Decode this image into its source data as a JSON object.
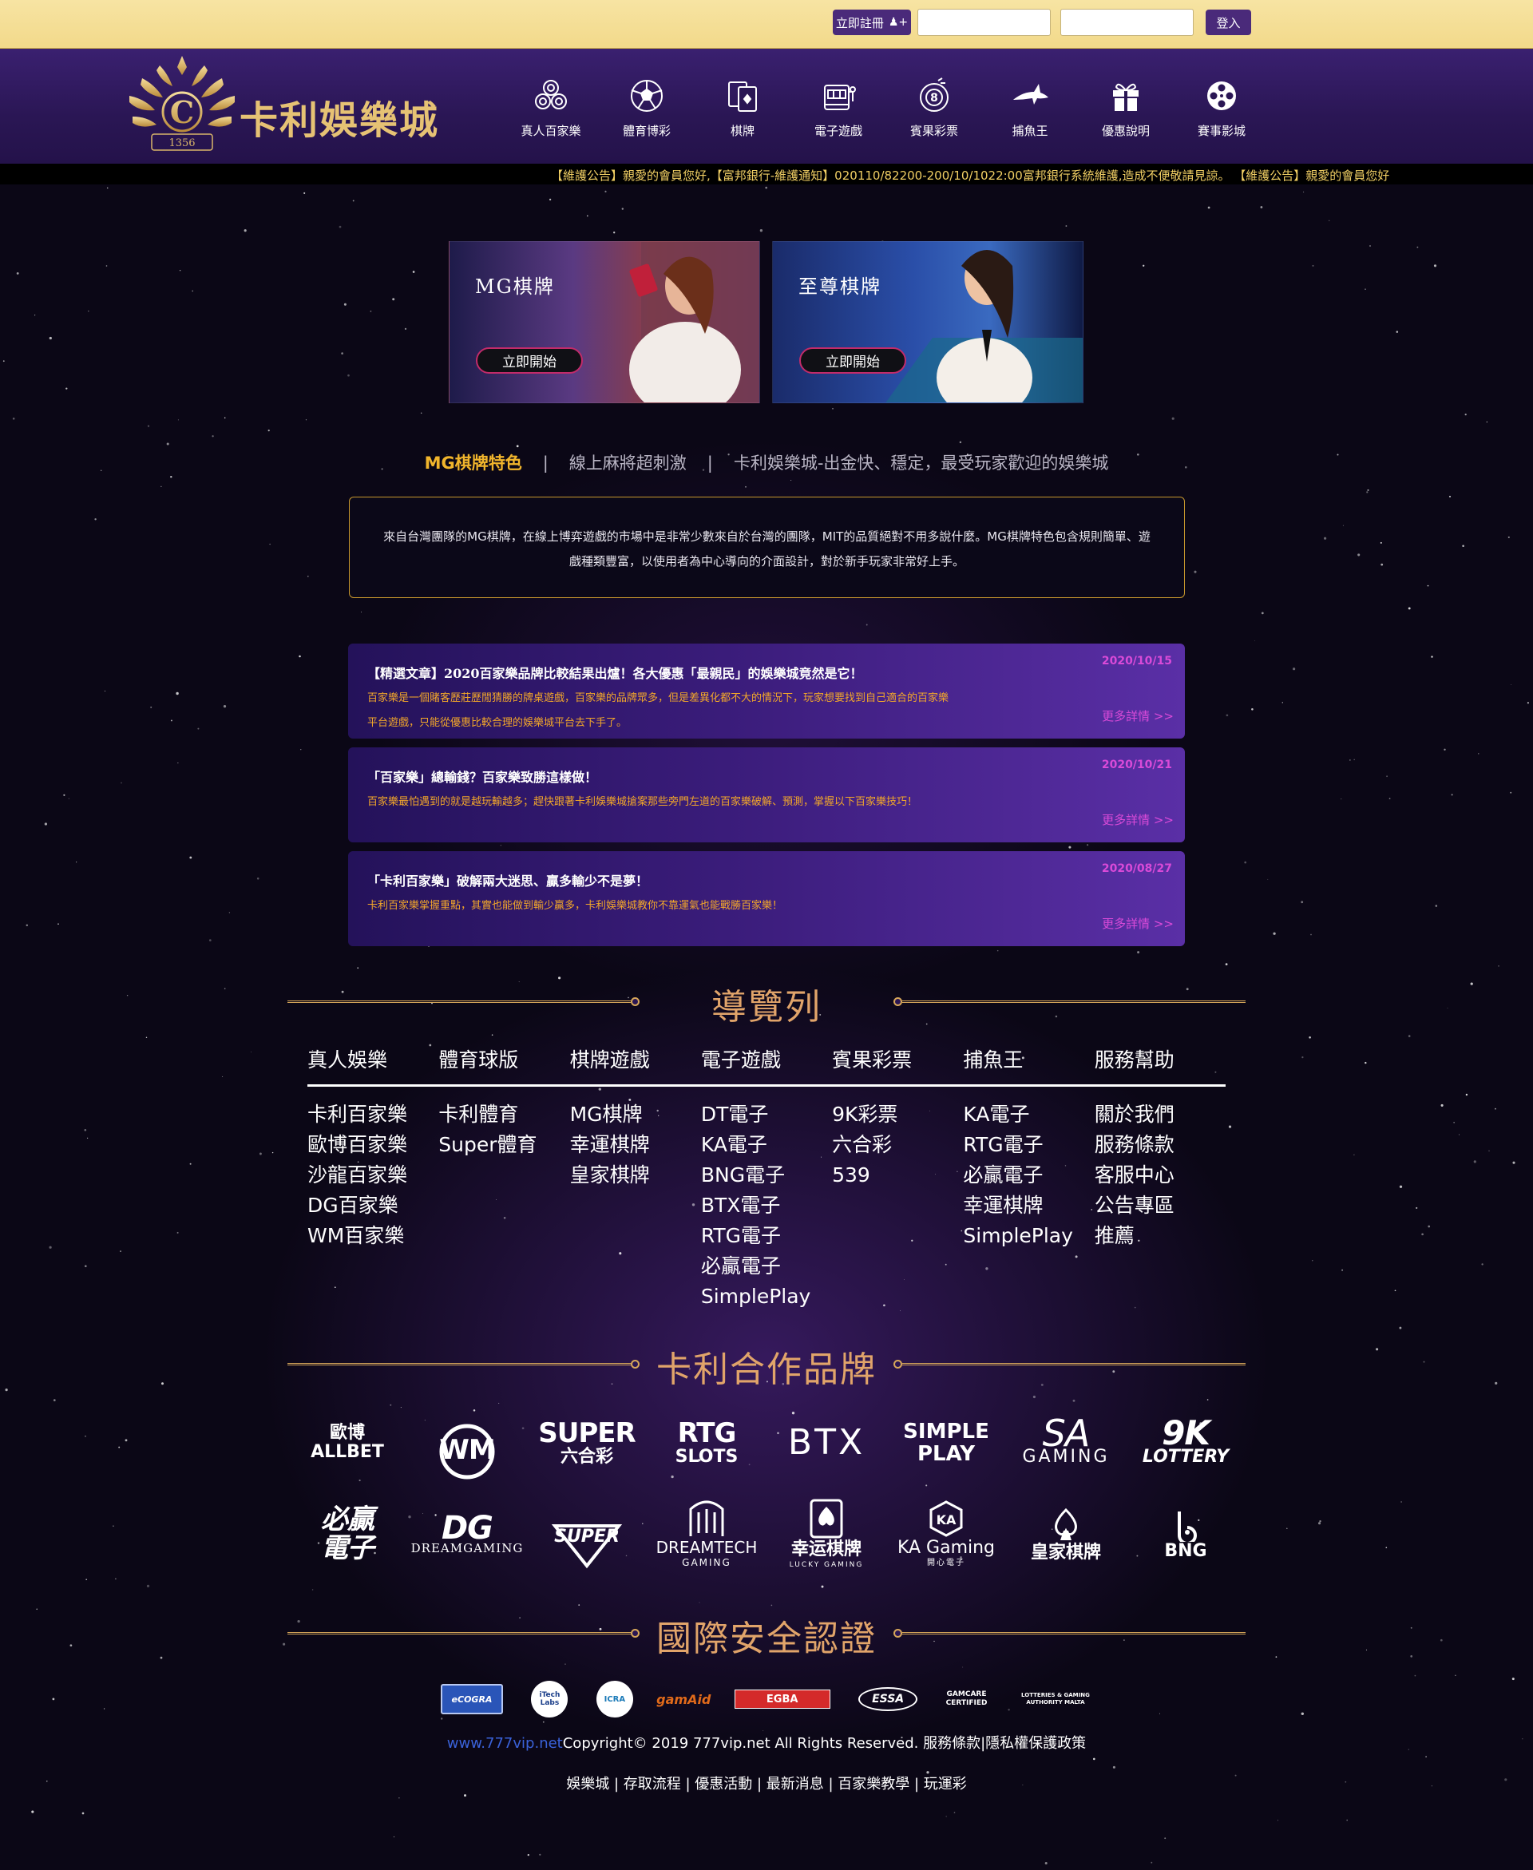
{
  "topbar": {
    "register_label": "立即註冊",
    "username_placeholder": "",
    "password_placeholder": "",
    "login_label": "登入"
  },
  "header": {
    "logo_text": "卡利娛樂城",
    "logo_number": "1356",
    "nav": [
      {
        "label": "真人百家樂",
        "icon": "chips-icon"
      },
      {
        "label": "體育博彩",
        "icon": "soccer-ball-icon"
      },
      {
        "label": "棋牌",
        "icon": "cards-icon"
      },
      {
        "label": "電子遊戲",
        "icon": "slot-machine-icon"
      },
      {
        "label": "賓果彩票",
        "icon": "bingo-ball-icon"
      },
      {
        "label": "捕魚王",
        "icon": "shark-icon"
      },
      {
        "label": "優惠說明",
        "icon": "gift-icon"
      },
      {
        "label": "賽事影城",
        "icon": "film-reel-icon"
      }
    ]
  },
  "marquee": "【維護公告】親愛的會員您好,【富邦銀行-維護通知】020110/82200-200/10/1022:00富邦銀行系統維護,造成不便敬請見諒。 【維護公告】親愛的會員您好",
  "banners": [
    {
      "title": "MG棋牌",
      "button": "立即開始"
    },
    {
      "title": "至尊棋牌",
      "button": "立即開始"
    }
  ],
  "section": {
    "highlight": "MG棋牌特色",
    "sep": "|",
    "sub1": "線上麻將超刺激",
    "sub2": "卡利娛樂城-出金快、穩定，最受玩家歡迎的娛樂城"
  },
  "intro": "來自台灣團隊的MG棋牌，在線上博弈遊戲的市場中是非常少數來自於台灣的團隊，MIT的品質絕對不用多說什麼。MG棋牌特色包含規則簡單、遊戲種類豐富，以使用者為中心導向的介面設計，對於新手玩家非常好上手。",
  "articles": [
    {
      "date": "2020/10/15",
      "title": "【精選文章】2020百家樂品牌比較結果出爐！各大優惠「最親民」的娛樂城竟然是它！",
      "desc": "百家樂是一個賭客歷莊歷閒猜勝的牌桌遊戲，百家樂的品牌眾多，但是差異化都不大的情況下，玩家想要找到自己適合的百家樂平台遊戲，只能從優惠比較合理的娛樂城平台去下手了。",
      "more": "更多詳情 >>"
    },
    {
      "date": "2020/10/21",
      "title": "「百家樂」總輸錢？百家樂致勝這樣做！",
      "desc": "百家樂最怕遇到的就是越玩輸越多；趕快跟著卡利娛樂城搶案那些旁門左道的百家樂破解、預測，掌握以下百家樂技巧！",
      "more": "更多詳情 >>"
    },
    {
      "date": "2020/08/27",
      "title": "「卡利百家樂」破解兩大迷思、贏多輸少不是夢！",
      "desc": "卡利百家樂掌握重點，其實也能做到輸少贏多，卡利娛樂城教你不靠運氣也能戰勝百家樂！",
      "more": "更多詳情 >>"
    }
  ],
  "navlist": {
    "title": "導覽列",
    "columns": [
      {
        "head": "真人娛樂",
        "items": [
          "卡利百家樂",
          "歐博百家樂",
          "沙龍百家樂",
          "DG百家樂",
          "WM百家樂"
        ]
      },
      {
        "head": "體育球版",
        "items": [
          "卡利體育",
          "Super體育"
        ]
      },
      {
        "head": "棋牌遊戲",
        "items": [
          "MG棋牌",
          "幸運棋牌",
          "皇家棋牌"
        ]
      },
      {
        "head": "電子遊戲",
        "items": [
          "DT電子",
          "KA電子",
          "BNG電子",
          "BTX電子",
          "RTG電子",
          "必贏電子",
          "SimplePlay"
        ]
      },
      {
        "head": "賓果彩票",
        "items": [
          "9K彩票",
          "六合彩",
          "539"
        ]
      },
      {
        "head": "捕魚王",
        "items": [
          "KA電子",
          "RTG電子",
          "必贏電子",
          "幸運棋牌",
          "SimplePlay"
        ]
      },
      {
        "head": "服務幫助",
        "items": [
          "關於我們",
          "服務條款",
          "客服中心",
          "公告專區",
          "推薦"
        ]
      }
    ]
  },
  "brands": {
    "title": "卡利合作品牌",
    "row1": [
      {
        "main": "ALLBET",
        "sub": "歐博"
      },
      {
        "main": "WM",
        "sub": ""
      },
      {
        "main": "SUPER",
        "sub": "六合彩"
      },
      {
        "main": "RTG",
        "sub": "SLOTS"
      },
      {
        "main": "BTX",
        "sub": ""
      },
      {
        "main": "SIMPLE PLAY",
        "sub": ""
      },
      {
        "main": "SA",
        "sub": "GAMING"
      },
      {
        "main": "9K",
        "sub": "LOTTERY"
      }
    ],
    "row2": [
      {
        "main": "必贏",
        "sub": "電子"
      },
      {
        "main": "DG",
        "sub": "DREAMGAMING"
      },
      {
        "main": "SUPER",
        "sub": ""
      },
      {
        "main": "DREAMTECH",
        "sub": "GAMING"
      },
      {
        "main": "幸运棋牌",
        "sub": "LUCKY GAMING"
      },
      {
        "main": "KA Gaming",
        "sub": "開心電子"
      },
      {
        "main": "皇家棋牌",
        "sub": ""
      },
      {
        "main": "BNG",
        "sub": ""
      }
    ]
  },
  "certs": {
    "title": "國際安全認證",
    "items": [
      "eCOGRA",
      "iTech Labs",
      "ICRA",
      "gamAid",
      "EGBA",
      "ESSA",
      "GAMCARE CERTIFIED",
      "LOTTERIES & GAMING AUTHORITY MALTA"
    ]
  },
  "footer": {
    "link": "www.777vip.net",
    "copyright": "Copyright© 2019 777vip.net All Rights Reserved. 服務條款|隱私權保護政策",
    "links": "娛樂城 | 存取流程 | 優惠活動 | 最新消息 | 百家樂教學 | 玩運彩"
  },
  "colors": {
    "accent_gold": "#e1a46a",
    "header_purple": "#2a1654",
    "link_magenta": "#d94ad8",
    "highlight_orange": "#f1b52c"
  }
}
